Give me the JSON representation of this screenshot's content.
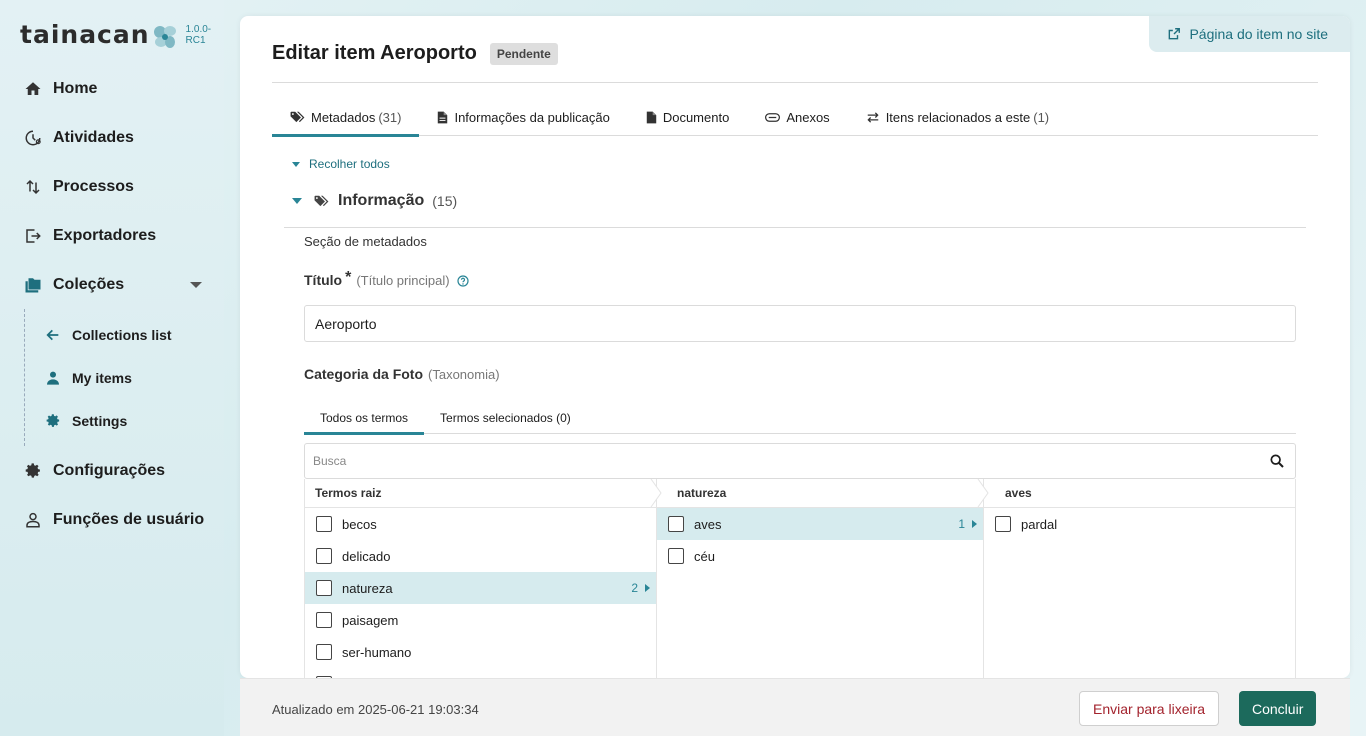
{
  "app": {
    "logo_text": "Tainacan",
    "version": "1.0.0-RC1"
  },
  "sidebar": {
    "items": [
      {
        "label": "Home",
        "icon": "home-icon"
      },
      {
        "label": "Atividades",
        "icon": "activity-icon"
      },
      {
        "label": "Processos",
        "icon": "processes-icon"
      },
      {
        "label": "Exportadores",
        "icon": "export-icon"
      },
      {
        "label": "Coleções",
        "icon": "collections-icon"
      },
      {
        "label": "Configurações",
        "icon": "gear-icon"
      },
      {
        "label": "Funções de usuário",
        "icon": "user-roles-icon"
      }
    ],
    "subitems": [
      {
        "label": "Collections list",
        "icon": "arrow-left-icon"
      },
      {
        "label": "My items",
        "icon": "person-icon"
      },
      {
        "label": "Settings",
        "icon": "gear-icon"
      }
    ]
  },
  "header": {
    "site_link": "Página do item no site",
    "title": "Editar item Aeroporto",
    "status_badge": "Pendente"
  },
  "tabs": [
    {
      "label": "Metadados",
      "count": "(31)",
      "active": true
    },
    {
      "label": "Informações da publicação",
      "count": ""
    },
    {
      "label": "Documento",
      "count": ""
    },
    {
      "label": "Anexos",
      "count": ""
    },
    {
      "label": "Itens relacionados a este",
      "count": "(1)"
    }
  ],
  "metadata": {
    "collapse_all": "Recolher todos",
    "section": {
      "title": "Informação",
      "count": "(15)",
      "description": "Seção de metadados"
    },
    "title_field": {
      "label": "Título",
      "required_mark": "*",
      "hint": "(Título principal)",
      "value": "Aeroporto"
    },
    "category_field": {
      "label": "Categoria da Foto",
      "hint": "(Taxonomia)",
      "subtabs": [
        "Todos os termos",
        "Termos selecionados (0)"
      ],
      "search_placeholder": "Busca",
      "columns": [
        {
          "header": "Termos raiz",
          "rows": [
            {
              "label": "becos"
            },
            {
              "label": "delicado"
            },
            {
              "label": "natureza",
              "count": "2",
              "selected": true
            },
            {
              "label": "paisagem"
            },
            {
              "label": "ser-humano"
            },
            {
              "label": "tecnologia"
            }
          ]
        },
        {
          "header": "natureza",
          "rows": [
            {
              "label": "aves",
              "count": "1",
              "selected": true
            },
            {
              "label": "céu"
            }
          ]
        },
        {
          "header": "aves",
          "rows": [
            {
              "label": "pardal"
            }
          ]
        }
      ]
    }
  },
  "footer": {
    "updated": "Atualizado em 2025-06-21 19:03:34",
    "trash_button": "Enviar para lixeira",
    "done_button": "Concluir"
  },
  "colors": {
    "accent": "#298596",
    "primary_button": "#1c6a5c",
    "danger_text": "#a3232d",
    "selected_row": "#d6ebee"
  }
}
